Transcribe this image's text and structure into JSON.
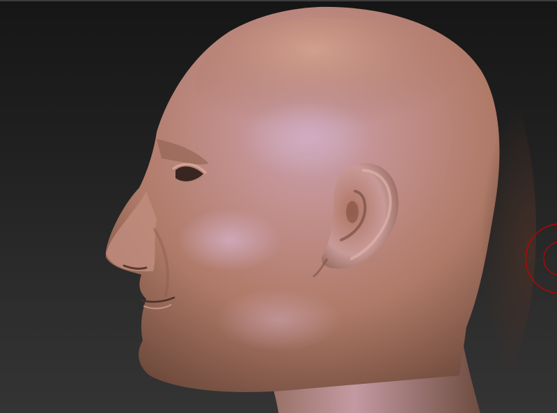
{
  "viewport": {
    "content": "3d-sculpt-head-model",
    "background_top": "#161616",
    "background_bottom": "#343434",
    "material_base": "#c48a78",
    "material_highlight": "#c9a0b0",
    "material_shadow": "#6e4a3c",
    "gizmo_color": "#c00000"
  },
  "icons": [
    "rotation-gizmo-icon"
  ]
}
